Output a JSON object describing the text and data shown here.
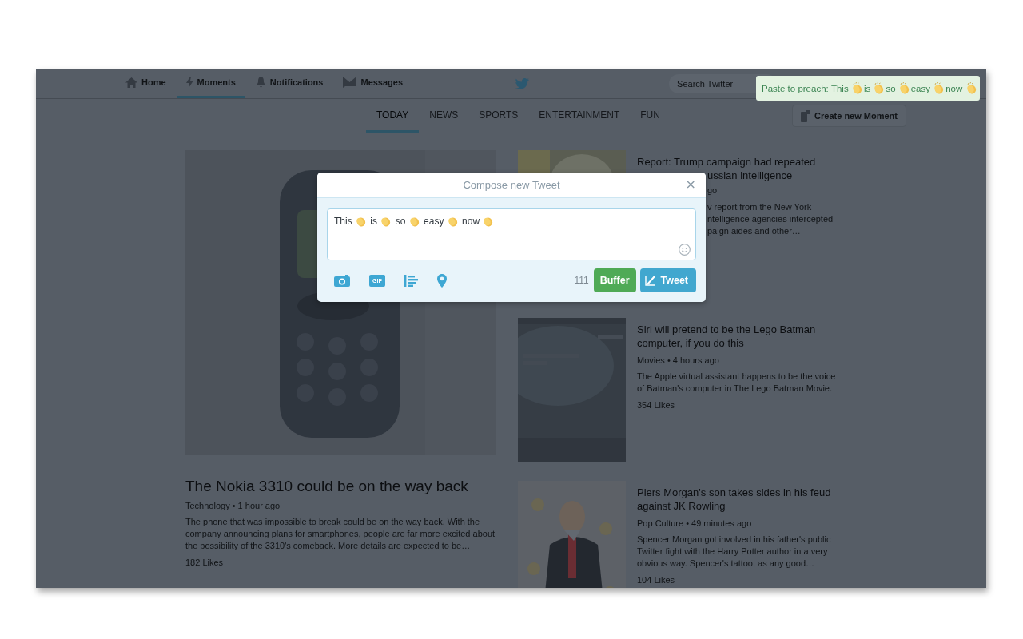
{
  "nav": {
    "items": [
      {
        "label": "Home",
        "selected": false
      },
      {
        "label": "Moments",
        "selected": true
      },
      {
        "label": "Notifications",
        "selected": false
      },
      {
        "label": "Messages",
        "selected": false
      }
    ],
    "search": {
      "placeholder": "Search Twitter"
    }
  },
  "toast": {
    "lead": "Paste to preach:",
    "words": [
      "This",
      "is",
      "so",
      "easy",
      "now"
    ]
  },
  "subnav": {
    "tabs": [
      {
        "label": "TODAY",
        "selected": true
      },
      {
        "label": "NEWS",
        "selected": false
      },
      {
        "label": "SPORTS",
        "selected": false
      },
      {
        "label": "ENTERTAINMENT",
        "selected": false
      },
      {
        "label": "FUN",
        "selected": false
      }
    ],
    "create_button": "Create new Moment"
  },
  "feature": {
    "title": "The Nokia 3310 could be on the way back",
    "meta": "Technology • 1 hour ago",
    "summary": "The phone that was impossible to break could be on the way back. With the company announcing plans for smartphones, people are far more excited about the possibility of the 3310's comeback. More details are expected to be…",
    "likes": "182 Likes"
  },
  "covered_story": {
    "title": "Report: Trump campaign had repeated",
    "title_fragment": "ussian intelligence",
    "meta_fragment": "go",
    "summary_fragments": [
      "v report from the New York",
      "ntelligence agencies intercepted",
      "paign aides and other…"
    ]
  },
  "stories": [
    {
      "title": "Siri will pretend to be the Lego Batman computer, if you do this",
      "meta": "Movies • 4 hours ago",
      "summary": "The Apple virtual assistant happens to be the voice of Batman's computer in The Lego Batman Movie.",
      "likes": "354 Likes"
    },
    {
      "title": "Piers Morgan's son takes sides in his feud against JK Rowling",
      "meta": "Pop Culture • 49 minutes ago",
      "summary": "Spencer Morgan got involved in his father's public Twitter fight with the Harry Potter author in a very obvious way. Spencer's tattoo, as any good…",
      "likes": "104 Likes"
    }
  ],
  "compose": {
    "title": "Compose new Tweet",
    "close": "×",
    "words": [
      "This",
      "is",
      "so",
      "easy",
      "now"
    ],
    "gif_label": "GIF",
    "count": "111",
    "buffer_button": "Buffer",
    "tweet_button": "Tweet"
  }
}
